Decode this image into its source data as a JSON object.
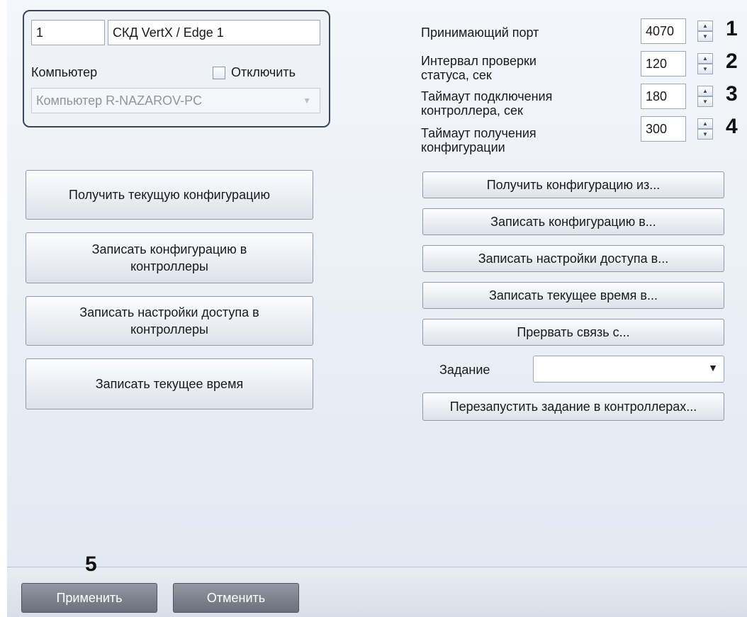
{
  "device": {
    "id": "1",
    "name": "СКД VertX / Edge 1",
    "computer_label": "Компьютер",
    "disable_label": "Отключить",
    "computer_value": "Компьютер R-NAZAROV-PC"
  },
  "params": [
    {
      "label": "Принимающий порт",
      "value": "4070",
      "marker": "1"
    },
    {
      "label": "Интервал проверки статуса, сек",
      "value": "120",
      "marker": "2"
    },
    {
      "label": "Таймаут подключения контроллера, сек",
      "value": "180",
      "marker": "3"
    },
    {
      "label": "Таймаут получения конфигурации",
      "value": "300",
      "marker": "4"
    }
  ],
  "left_buttons": {
    "get_config": "Получить текущую конфигурацию",
    "write_config": "Записать конфигурацию в контроллеры",
    "write_access": "Записать настройки доступа в контроллеры",
    "write_time": "Записать текущее время"
  },
  "right_buttons": {
    "get_config_from": "Получить конфигурацию из...",
    "write_config_to": "Записать конфигурацию в...",
    "write_access_to": "Записать настройки доступа в...",
    "write_time_to": "Записать текущее время в...",
    "break_link": "Прервать связь с...",
    "restart_task": "Перезапустить задание в контроллерах..."
  },
  "task": {
    "label": "Задание",
    "value": ""
  },
  "footer": {
    "marker": "5",
    "apply": "Применить",
    "cancel": "Отменить"
  },
  "icons": {
    "spin_up": "arrow-up-icon",
    "spin_down": "arrow-down-icon",
    "dropdown": "chevron-down-icon"
  }
}
